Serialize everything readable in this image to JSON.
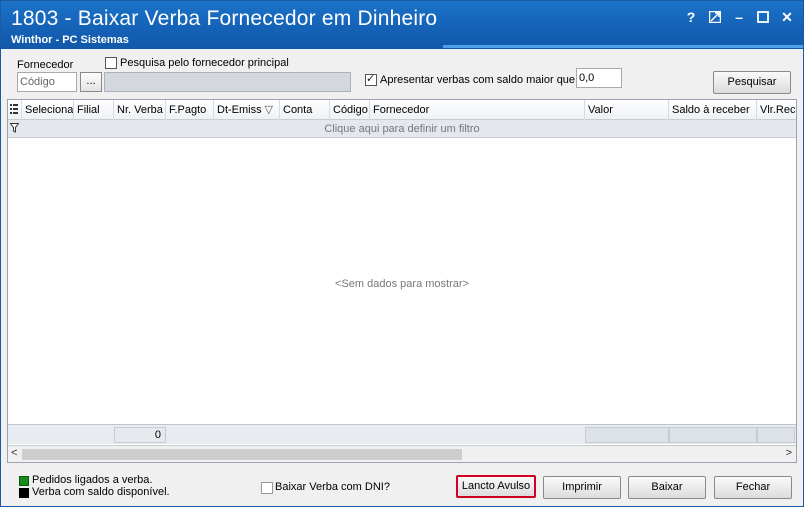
{
  "window": {
    "title": "1803 - Baixar Verba Fornecedor em Dinheiro",
    "subtitle": "Winthor - PC Sistemas",
    "controls": [
      "?",
      "⤢",
      "–",
      "☐",
      "✕"
    ]
  },
  "filter": {
    "fornecedor_label": "Fornecedor",
    "codigo_placeholder": "Código",
    "browse_label": "...",
    "principal_checkbox_label": "Pesquisa pelo fornecedor principal",
    "principal_checked": false,
    "saldo_checkbox_label": "Apresentar verbas com saldo maior que",
    "saldo_checked": true,
    "saldo_value": "0,0",
    "search_button": "Pesquisar"
  },
  "grid": {
    "columns": [
      "Selecionado",
      "Filial",
      "Nr. Verba",
      "F.Pagto",
      "Dt-Emiss",
      "Conta",
      "Código",
      "Fornecedor",
      "Valor",
      "Saldo à receber",
      "Vlr.Recebido"
    ],
    "filter_prompt": "Clique aqui para definir um filtro",
    "empty_message": "<Sem dados para mostrar>",
    "footer_count": "0"
  },
  "legend": {
    "items": [
      {
        "label": "Pedidos ligados a verba.",
        "color": "#1a8a1a"
      },
      {
        "label": "Verba com saldo disponível.",
        "color": "#000000"
      }
    ]
  },
  "bottom": {
    "dni_checkbox_label": "Baixar Verba com DNI?",
    "dni_checked": false,
    "buttons": {
      "lancto": "Lancto Avulso",
      "imprimir": "Imprimir",
      "baixar": "Baixar",
      "fechar": "Fechar"
    }
  },
  "colors": {
    "titlebar": "#1461b6",
    "highlight_border": "#d00020"
  }
}
